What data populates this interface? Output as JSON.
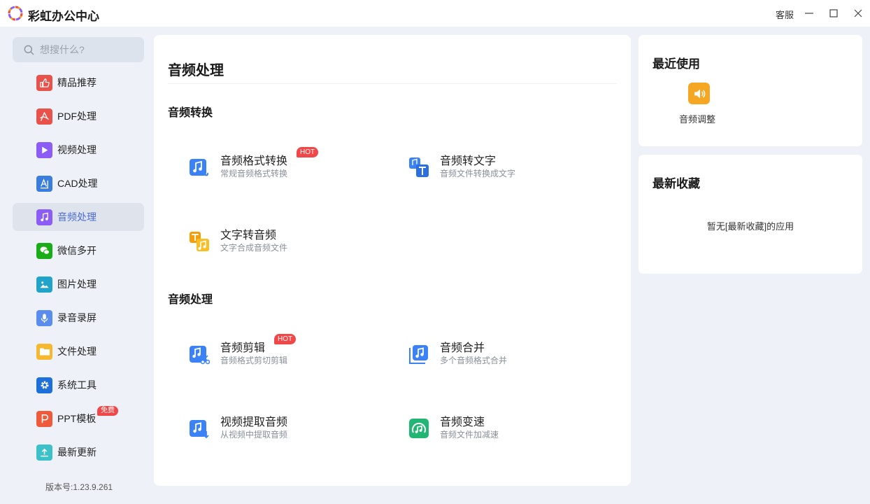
{
  "app": {
    "title": "彩虹办公中心"
  },
  "titlebar": {
    "service_label": "客服"
  },
  "search": {
    "placeholder": "想搜什么?"
  },
  "sidebar": {
    "items": [
      {
        "label": "精品推荐",
        "icon": "thumbs-up-icon",
        "color": "#e9524a"
      },
      {
        "label": "PDF处理",
        "icon": "pdf-icon",
        "color": "#e9524a"
      },
      {
        "label": "视频处理",
        "icon": "play-icon",
        "color": "#8b5cf6"
      },
      {
        "label": "CAD处理",
        "icon": "cad-icon",
        "color": "#3b7ddd"
      },
      {
        "label": "音频处理",
        "icon": "music-note-icon",
        "color": "#8b5cf6"
      },
      {
        "label": "微信多开",
        "icon": "wechat-icon",
        "color": "#1aad19"
      },
      {
        "label": "图片处理",
        "icon": "image-icon",
        "color": "#22a3c9"
      },
      {
        "label": "录音录屏",
        "icon": "microphone-icon",
        "color": "#5b8def"
      },
      {
        "label": "文件处理",
        "icon": "folder-icon",
        "color": "#f5b82e"
      },
      {
        "label": "系统工具",
        "icon": "gear-icon",
        "color": "#1e6fd9"
      },
      {
        "label": "PPT模板",
        "icon": "ppt-icon",
        "color": "#ef5b3a",
        "badge": "免费"
      },
      {
        "label": "最新更新",
        "icon": "upload-icon",
        "color": "#3cc0c9"
      }
    ],
    "active_index": 4,
    "version": "版本号:1.23.9.261"
  },
  "main": {
    "title": "音频处理",
    "sections": [
      {
        "title": "音频转换",
        "tools": [
          {
            "name": "音频格式转换",
            "desc": "常规音频格式转换",
            "hot": "HOT",
            "icon": "audio-format-convert-icon"
          },
          {
            "name": "音频转文字",
            "desc": "音频文件转换成文字",
            "icon": "audio-to-text-icon"
          },
          {
            "name": "文字转音频",
            "desc": "文字合成音频文件",
            "icon": "text-to-audio-icon"
          }
        ]
      },
      {
        "title": "音频处理",
        "tools": [
          {
            "name": "音频剪辑",
            "desc": "音频格式剪切剪辑",
            "hot": "HOT",
            "icon": "audio-cut-icon"
          },
          {
            "name": "音频合并",
            "desc": "多个音频格式合并",
            "icon": "audio-merge-icon"
          },
          {
            "name": "视频提取音频",
            "desc": "从视频中提取音频",
            "icon": "video-extract-audio-icon"
          },
          {
            "name": "音频变速",
            "desc": "音频文件加减速",
            "icon": "audio-speed-icon"
          }
        ]
      }
    ]
  },
  "recent": {
    "title": "最近使用",
    "items": [
      {
        "label": "音频调整",
        "icon": "speaker-icon"
      }
    ]
  },
  "favorites": {
    "title": "最新收藏",
    "empty_text": "暂无[最新收藏]的应用"
  }
}
